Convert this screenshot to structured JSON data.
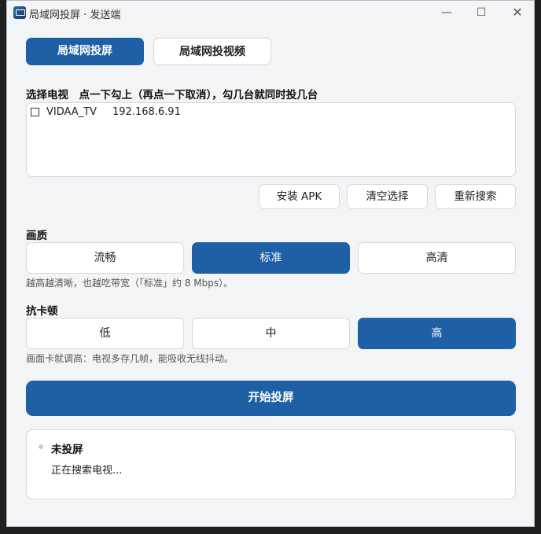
{
  "window": {
    "title": "局域网投屏 · 发送端",
    "controls": {
      "minimize": "—",
      "maximize": "☐",
      "close": "✕"
    }
  },
  "tabs": [
    {
      "label": "局域网投屏",
      "active": true
    },
    {
      "label": "局域网投视频",
      "active": false
    }
  ],
  "tv_select": {
    "label": "选择电视　点一下勾上（再点一下取消），勾几台就同时投几台",
    "devices": [
      {
        "name": "VIDAA_TV",
        "ip": "192.168.6.91",
        "checked": false
      }
    ]
  },
  "actions": {
    "install_apk": "安装 APK",
    "clear_selection": "清空选择",
    "rescan": "重新搜索"
  },
  "quality": {
    "label": "画质",
    "options": [
      "流畅",
      "标准",
      "高清"
    ],
    "selected": "标准",
    "hint": "越高越清晰，也越吃带宽（「标准」约 8 Mbps）。"
  },
  "anti_stutter": {
    "label": "抗卡顿",
    "options": [
      "低",
      "中",
      "高"
    ],
    "selected": "高",
    "hint": "画面卡就调高：电视多存几帧，能吸收无线抖动。"
  },
  "start_button": "开始投屏",
  "status": {
    "title": "未投屏",
    "detail": "正在搜索电视..."
  },
  "colors": {
    "accent": "#1e5fa6",
    "background": "#f3f4f6",
    "card": "#ffffff"
  }
}
